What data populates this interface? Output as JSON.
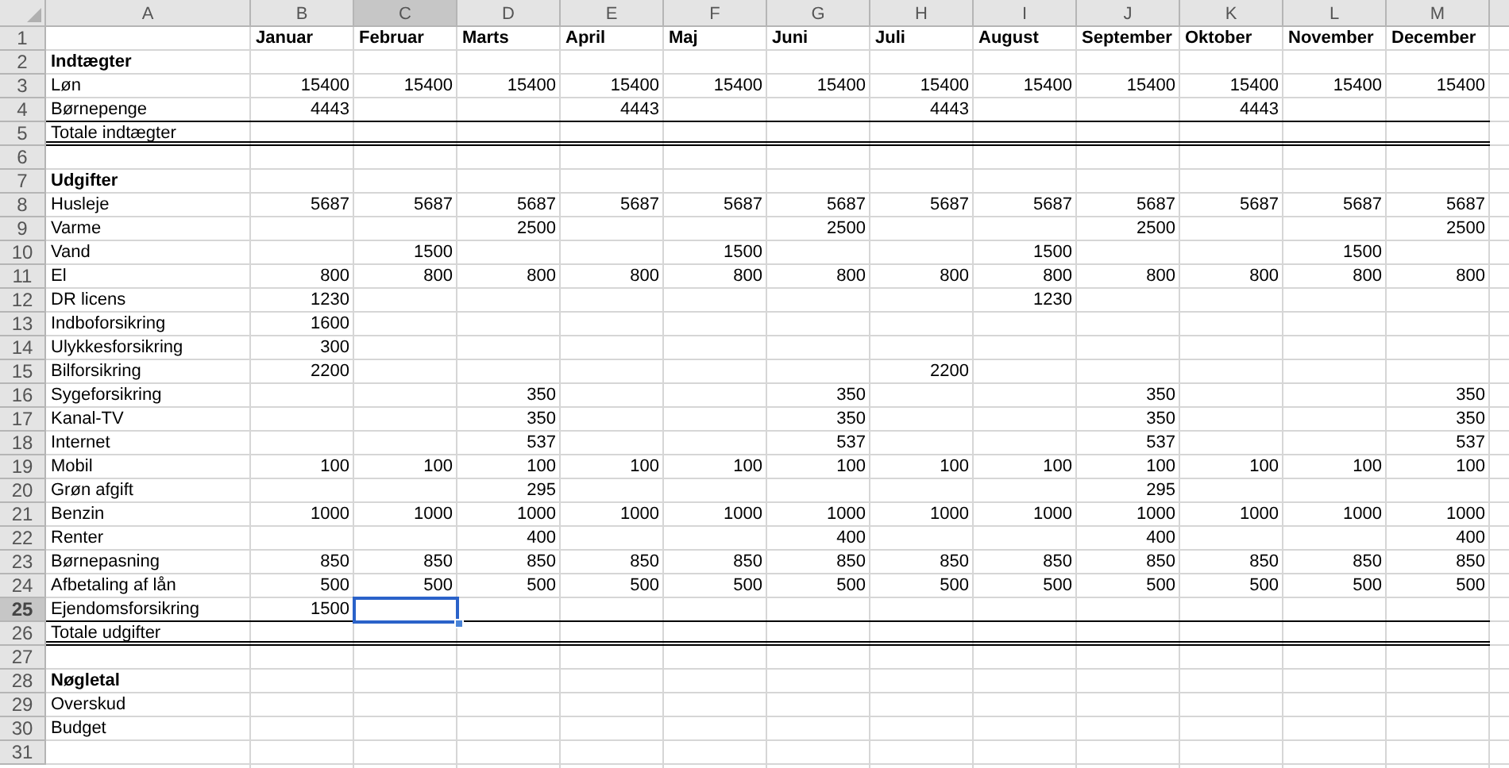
{
  "columns": [
    {
      "letter": "A",
      "selected": false
    },
    {
      "letter": "B",
      "selected": false
    },
    {
      "letter": "C",
      "selected": true
    },
    {
      "letter": "D",
      "selected": false
    },
    {
      "letter": "E",
      "selected": false
    },
    {
      "letter": "F",
      "selected": false
    },
    {
      "letter": "G",
      "selected": false
    },
    {
      "letter": "H",
      "selected": false
    },
    {
      "letter": "I",
      "selected": false
    },
    {
      "letter": "J",
      "selected": false
    },
    {
      "letter": "K",
      "selected": false
    },
    {
      "letter": "L",
      "selected": false
    },
    {
      "letter": "M",
      "selected": false
    }
  ],
  "rows": [
    {
      "number": "1",
      "kind": "header",
      "selected": false,
      "values": {
        "B": "Januar",
        "C": "Februar",
        "D": "Marts",
        "E": "April",
        "F": "Maj",
        "G": "Juni",
        "H": "Juli",
        "I": "August",
        "J": "September",
        "K": "Oktober",
        "L": "November",
        "M": "December"
      }
    },
    {
      "number": "2",
      "kind": "section",
      "selected": false,
      "label": "Indtægter"
    },
    {
      "number": "3",
      "kind": "item",
      "selected": false,
      "label": "Løn",
      "values": {
        "B": "15400",
        "C": "15400",
        "D": "15400",
        "E": "15400",
        "F": "15400",
        "G": "15400",
        "H": "15400",
        "I": "15400",
        "J": "15400",
        "K": "15400",
        "L": "15400",
        "M": "15400"
      }
    },
    {
      "number": "4",
      "kind": "item",
      "selected": false,
      "label": "Børnepenge",
      "values": {
        "B": "4443",
        "E": "4443",
        "H": "4443",
        "K": "4443"
      }
    },
    {
      "number": "5",
      "kind": "total",
      "selected": false,
      "label": "Totale indtægter"
    },
    {
      "number": "6",
      "kind": "item",
      "selected": false
    },
    {
      "number": "7",
      "kind": "section",
      "selected": false,
      "label": "Udgifter"
    },
    {
      "number": "8",
      "kind": "item",
      "selected": false,
      "label": "Husleje",
      "values": {
        "B": "5687",
        "C": "5687",
        "D": "5687",
        "E": "5687",
        "F": "5687",
        "G": "5687",
        "H": "5687",
        "I": "5687",
        "J": "5687",
        "K": "5687",
        "L": "5687",
        "M": "5687"
      }
    },
    {
      "number": "9",
      "kind": "item",
      "selected": false,
      "label": "Varme",
      "values": {
        "D": "2500",
        "G": "2500",
        "J": "2500",
        "M": "2500"
      }
    },
    {
      "number": "10",
      "kind": "item",
      "selected": false,
      "label": "Vand",
      "values": {
        "C": "1500",
        "F": "1500",
        "I": "1500",
        "L": "1500"
      }
    },
    {
      "number": "11",
      "kind": "item",
      "selected": false,
      "label": "El",
      "values": {
        "B": "800",
        "C": "800",
        "D": "800",
        "E": "800",
        "F": "800",
        "G": "800",
        "H": "800",
        "I": "800",
        "J": "800",
        "K": "800",
        "L": "800",
        "M": "800"
      }
    },
    {
      "number": "12",
      "kind": "item",
      "selected": false,
      "label": "DR licens",
      "values": {
        "B": "1230",
        "I": "1230"
      }
    },
    {
      "number": "13",
      "kind": "item",
      "selected": false,
      "label": "Indboforsikring",
      "values": {
        "B": "1600"
      }
    },
    {
      "number": "14",
      "kind": "item",
      "selected": false,
      "label": "Ulykkesforsikring",
      "values": {
        "B": "300"
      }
    },
    {
      "number": "15",
      "kind": "item",
      "selected": false,
      "label": "Bilforsikring",
      "values": {
        "B": "2200",
        "H": "2200"
      }
    },
    {
      "number": "16",
      "kind": "item",
      "selected": false,
      "label": "Sygeforsikring",
      "values": {
        "D": "350",
        "G": "350",
        "J": "350",
        "M": "350"
      }
    },
    {
      "number": "17",
      "kind": "item",
      "selected": false,
      "label": "Kanal-TV",
      "values": {
        "D": "350",
        "G": "350",
        "J": "350",
        "M": "350"
      }
    },
    {
      "number": "18",
      "kind": "item",
      "selected": false,
      "label": "Internet",
      "values": {
        "D": "537",
        "G": "537",
        "J": "537",
        "M": "537"
      }
    },
    {
      "number": "19",
      "kind": "item",
      "selected": false,
      "label": "Mobil",
      "values": {
        "B": "100",
        "C": "100",
        "D": "100",
        "E": "100",
        "F": "100",
        "G": "100",
        "H": "100",
        "I": "100",
        "J": "100",
        "K": "100",
        "L": "100",
        "M": "100"
      }
    },
    {
      "number": "20",
      "kind": "item",
      "selected": false,
      "label": "Grøn afgift",
      "values": {
        "D": "295",
        "J": "295"
      }
    },
    {
      "number": "21",
      "kind": "item",
      "selected": false,
      "label": "Benzin",
      "values": {
        "B": "1000",
        "C": "1000",
        "D": "1000",
        "E": "1000",
        "F": "1000",
        "G": "1000",
        "H": "1000",
        "I": "1000",
        "J": "1000",
        "K": "1000",
        "L": "1000",
        "M": "1000"
      }
    },
    {
      "number": "22",
      "kind": "item",
      "selected": false,
      "label": "Renter",
      "values": {
        "D": "400",
        "G": "400",
        "J": "400",
        "M": "400"
      }
    },
    {
      "number": "23",
      "kind": "item",
      "selected": false,
      "label": "Børnepasning",
      "values": {
        "B": "850",
        "C": "850",
        "D": "850",
        "E": "850",
        "F": "850",
        "G": "850",
        "H": "850",
        "I": "850",
        "J": "850",
        "K": "850",
        "L": "850",
        "M": "850"
      }
    },
    {
      "number": "24",
      "kind": "item",
      "selected": false,
      "label": "Afbetaling af lån",
      "values": {
        "B": "500",
        "C": "500",
        "D": "500",
        "E": "500",
        "F": "500",
        "G": "500",
        "H": "500",
        "I": "500",
        "J": "500",
        "K": "500",
        "L": "500",
        "M": "500"
      }
    },
    {
      "number": "25",
      "kind": "item",
      "selected": true,
      "label": "Ejendomsforsikring",
      "values": {
        "B": "1500"
      }
    },
    {
      "number": "26",
      "kind": "total",
      "selected": false,
      "label": "Totale udgifter"
    },
    {
      "number": "27",
      "kind": "item",
      "selected": false
    },
    {
      "number": "28",
      "kind": "section",
      "selected": false,
      "label": "Nøgletal"
    },
    {
      "number": "29",
      "kind": "item",
      "selected": false,
      "label": "Overskud"
    },
    {
      "number": "30",
      "kind": "item",
      "selected": false,
      "label": "Budget"
    },
    {
      "number": "31",
      "kind": "item",
      "selected": false
    }
  ]
}
